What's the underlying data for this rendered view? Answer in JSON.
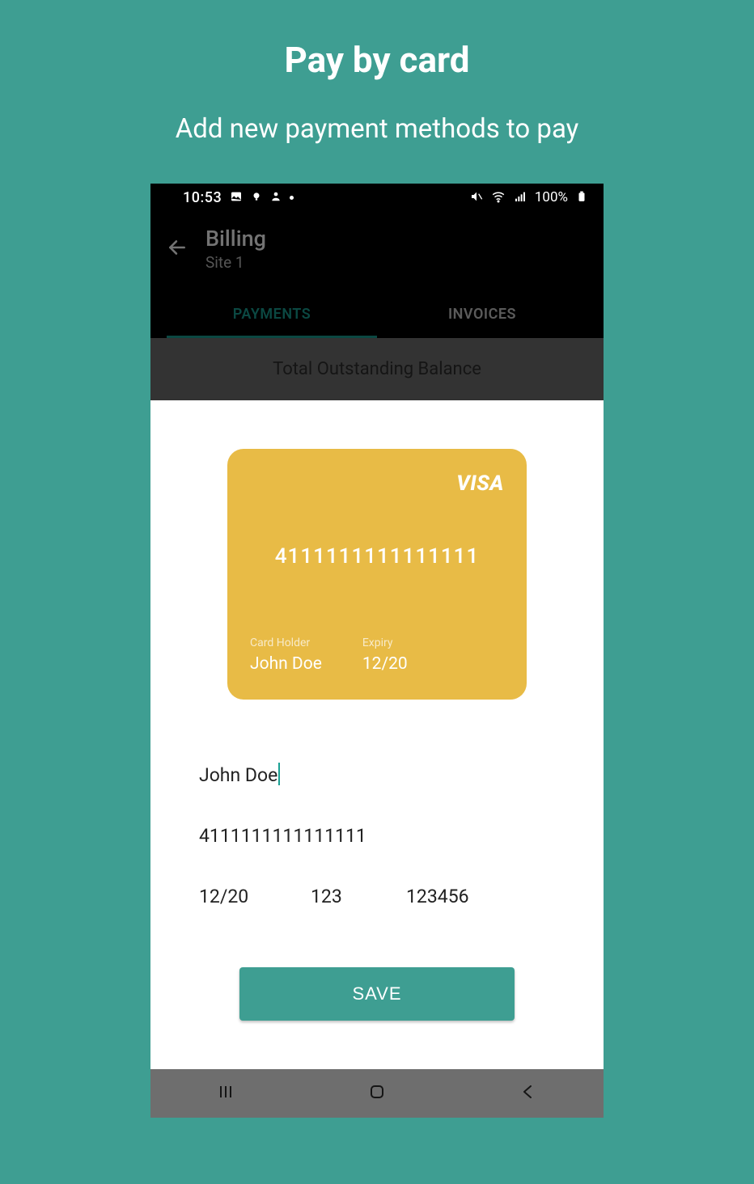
{
  "promo": {
    "title": "Pay by card",
    "subtitle": "Add new payment methods to pay"
  },
  "statusbar": {
    "time": "10:53",
    "battery_pct": "100%"
  },
  "appbar": {
    "title": "Billing",
    "subtitle": "Site 1"
  },
  "tabs": {
    "payments": "PAYMENTS",
    "invoices": "INVOICES"
  },
  "balance": {
    "label": "Total Outstanding Balance"
  },
  "card": {
    "brand": "VISA",
    "number": "4111111111111111",
    "holder_label": "Card Holder",
    "holder": "John Doe",
    "expiry_label": "Expiry",
    "expiry": "12/20"
  },
  "form": {
    "holder": "John Doe",
    "number": "4111111111111111",
    "expiry": "12/20",
    "cvv": "123",
    "zip": "123456",
    "save_label": "SAVE"
  }
}
